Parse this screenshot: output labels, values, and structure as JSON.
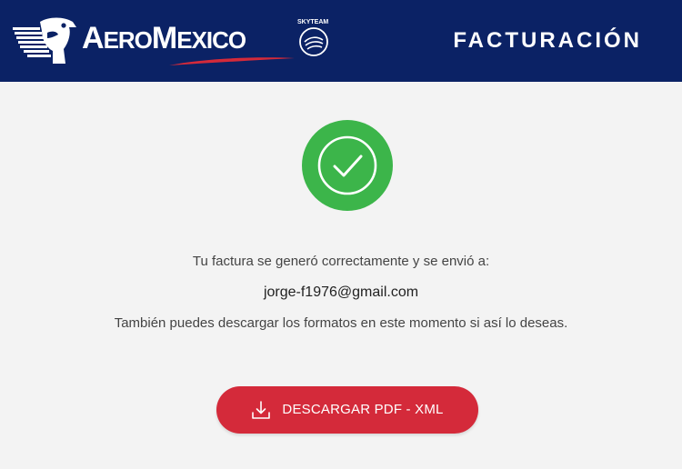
{
  "header": {
    "brand": "AeroMexico",
    "brand_caps_first": "A",
    "brand_rest_1": "ERO",
    "brand_caps_second": "M",
    "brand_rest_2": "EXICO",
    "alliance": "SKYTEAM",
    "title": "FACTURACIÓN",
    "background_color": "#0b2265"
  },
  "success": {
    "icon": "check-circle-icon",
    "color": "#3cb54a"
  },
  "messages": {
    "generated": "Tu factura se generó correctamente y se envió a:",
    "email": "jorge-f1976@gmail.com",
    "download_hint": "También puedes descargar los formatos en este momento si así lo deseas."
  },
  "download_button": {
    "label": "DESCARGAR PDF - XML",
    "icon": "download-icon",
    "color": "#d42a3a"
  }
}
